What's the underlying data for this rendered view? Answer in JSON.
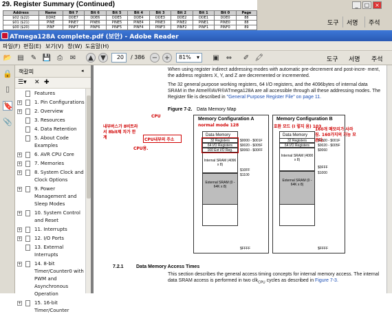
{
  "background_doc": {
    "title": "29.  Register Summary  (Continued)",
    "headers": [
      "Address",
      "Name",
      "Bit 7",
      "Bit 6",
      "Bit 5",
      "Bit 4",
      "Bit 3",
      "Bit 2",
      "Bit 1",
      "Bit 0",
      "Page"
    ],
    "rows": [
      [
        "$02 ($22)",
        "DDRE",
        "DDE7",
        "DDE6",
        "DDE5",
        "DDE4",
        "DDE3",
        "DDE2",
        "DDE1",
        "DDE0",
        "88"
      ],
      [
        "$01 ($21)",
        "PINE",
        "PINE7",
        "PINE6",
        "PINE5",
        "PINE4",
        "PINE3",
        "PINE2",
        "PINE1",
        "PINE0",
        "88"
      ],
      [
        "$00 ($20)",
        "PINF",
        "PINF7",
        "PINF6",
        "PINF5",
        "PINF4",
        "PINF3",
        "PINF2",
        "PINF1",
        "PINF0",
        "89"
      ]
    ],
    "right_buttons": [
      "도구",
      "서명",
      "주석"
    ]
  },
  "window": {
    "title": "ATmega128A complete.pdf (보안) - Adobe Reader",
    "menu": [
      "파일(F)",
      "편집(E)",
      "보기(V)",
      "창(W)",
      "도움말(H)"
    ],
    "page_current": "20",
    "page_total": "/ 386",
    "zoom": "81%",
    "toolbar_right": [
      "도구",
      "서명",
      "주석"
    ]
  },
  "bookmarks": {
    "header": "책갈피",
    "items": [
      {
        "label": "Features",
        "exp": false
      },
      {
        "label": "1. Pin Configurations",
        "exp": true
      },
      {
        "label": "2. Overview",
        "exp": true
      },
      {
        "label": "3. Resources",
        "exp": false
      },
      {
        "label": "4. Data Retention",
        "exp": false
      },
      {
        "label": "5. About Code Examples",
        "exp": false
      },
      {
        "label": "6. AVR CPU Core",
        "exp": true
      },
      {
        "label": "7. Memories",
        "exp": true
      },
      {
        "label": "8. System Clock and Clock Options",
        "exp": true
      },
      {
        "label": "9. Power Management and Sleep Modes",
        "exp": true
      },
      {
        "label": "10. System Control and Reset",
        "exp": true
      },
      {
        "label": "11. Interrupts",
        "exp": true
      },
      {
        "label": "12. I/O Ports",
        "exp": true
      },
      {
        "label": "13. External Interrupts",
        "exp": false
      },
      {
        "label": "14. 8-bit Timer/Counter0 with PWM and Asynchronous Operation",
        "exp": true
      },
      {
        "label": "15. 16-bit Timer/Counter",
        "exp": true
      }
    ]
  },
  "doc": {
    "p1": "When using register indirect addressing modes with automatic pre-decrement and post-incre- ment, the address registers X, Y, and Z are decremented or incremented.",
    "p2a": "The 32 general purpose working registers, 64 I/O registers, and the 4096bytes of internal data SRAM in the Atmel®AVR®ATmega128A are all accessible through all these addressing modes. The Register file is described in ",
    "p2link": "\"General Purpose Register File\" on page 11.",
    "figure_label": "Figure 7-2.",
    "figure_title": "Data Memory Map",
    "cfgA": "Memory Configuration A",
    "cfgB": "Memory Configuration B",
    "data_memory": "Data Memory",
    "A_cells": [
      "32 Registers",
      "64 I/O Registers",
      "160 Ext I/O Reg.",
      "Internal SRAM (4096 x 8)",
      "External SRAM (0 - 64K x 8)"
    ],
    "A_addr": [
      "$0000 - $001F",
      "$0020 - $005F",
      "$0060 - $00FF",
      "$10FF",
      "$1100",
      "$FFFF"
    ],
    "B_cells": [
      "32 Registers",
      "64 I/O Registers",
      "Internal SRAM (4000 x 8)",
      "External SRAM (0 - 64K x 8)"
    ],
    "B_addr": [
      "$0000 - $001F",
      "$0020 - $005F",
      "$0060",
      "$0FFF",
      "$1000",
      "$FFFF"
    ],
    "section_num": "7.2.1",
    "section_title": "Data Memory Access Times",
    "p3a": "This section describes the general access timing concepts for internal memory access. The internal data SRAM access is performed in two clk",
    "p3sub": "CPU",
    "p3b": " cycles as described in ",
    "p3link": "Figure 7-3."
  },
  "annotations": {
    "cpu": "CPU",
    "normal_mode": "normal mode 128",
    "bus_note": "내부버스가 8비트라서 8bit제 자가 한계",
    "cpu_inner": "CPU내부의 주소",
    "cpu_short": "CPU용.",
    "compat_note": "호환 모드 (I 렇지 음) 103",
    "ext_note": "160개 메모리가 사라짐. 160가지의 가능 모른다."
  }
}
